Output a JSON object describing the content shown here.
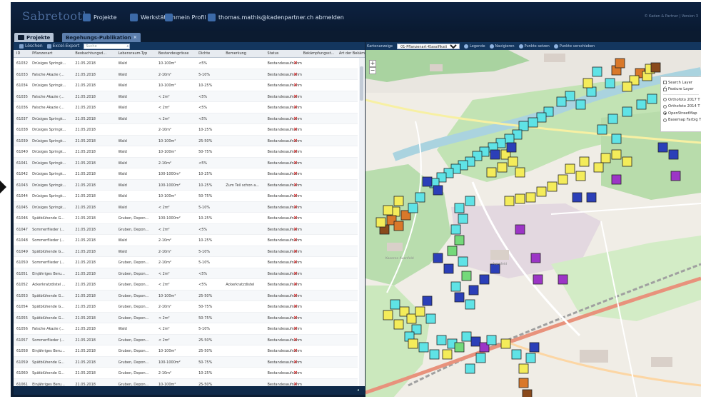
{
  "app": {
    "logo": "Sabretooth",
    "nav": [
      {
        "label": "Projekte"
      },
      {
        "label": "Werkstätten"
      },
      {
        "label": "mein Profil"
      },
      {
        "label": "thomas.mathis@kadenpartner.ch abmelden"
      }
    ],
    "top_right": "© Kaden & Partner | Version 3"
  },
  "tabs": [
    {
      "label": "Projekte"
    },
    {
      "label": "Begehungs-Publikation",
      "close": "×"
    }
  ],
  "grid_toolbar": {
    "delete": "Löschen",
    "export": "Excel-Export",
    "search_placeholder": "Suche"
  },
  "grid": {
    "headers": [
      "ID",
      "Pflanzenart",
      "Beobachtungsd...",
      "Lebensraum-Typ",
      "Bestandesgrösse",
      "Dichte",
      "Bemerkung",
      "Status",
      "Bekämpfungsst...",
      "Art der Bekämpf"
    ],
    "rows": [
      [
        "61032",
        "Drüsiges Springk...",
        "21.05.2018",
        "Wald",
        "10-100m²",
        "<5%",
        "",
        "Bestandesaufnahme"
      ],
      [
        "61033",
        "Falsche Akazie (...",
        "21.05.2018",
        "Wald",
        "2-10m²",
        "5-10%",
        "",
        "Bestandesaufnahme"
      ],
      [
        "61034",
        "Drüsiges Springk...",
        "21.05.2018",
        "Wald",
        "10-100m²",
        "10-25%",
        "",
        "Bestandesaufnahme"
      ],
      [
        "61035",
        "Falsche Akazie (...",
        "21.05.2018",
        "Wald",
        "< 2m²",
        "<5%",
        "",
        "Bestandesaufnahme"
      ],
      [
        "61036",
        "Falsche Akazie (...",
        "21.05.2018",
        "Wald",
        "< 2m²",
        "<5%",
        "",
        "Bestandesaufnahme"
      ],
      [
        "61037",
        "Drüsiges Springk...",
        "21.05.2018",
        "Wald",
        "< 2m²",
        "<5%",
        "",
        "Bestandesaufnahme"
      ],
      [
        "61038",
        "Drüsiges Springk...",
        "21.05.2018",
        "",
        "2-10m²",
        "10-25%",
        "",
        "Bestandesaufnahme"
      ],
      [
        "61039",
        "Drüsiges Springk...",
        "21.05.2018",
        "Wald",
        "10-100m²",
        "25-50%",
        "",
        "Bestandesaufnahme"
      ],
      [
        "61040",
        "Drüsiges Springk...",
        "21.05.2018",
        "Wald",
        "10-100m²",
        "50-75%",
        "",
        "Bestandesaufnahme"
      ],
      [
        "61041",
        "Drüsiges Springk...",
        "21.05.2018",
        "Wald",
        "2-10m²",
        "<5%",
        "",
        "Bestandesaufnahme"
      ],
      [
        "61042",
        "Drüsiges Springk...",
        "21.05.2018",
        "Wald",
        "100-1000m²",
        "10-25%",
        "",
        "Bestandesaufnahme"
      ],
      [
        "61043",
        "Drüsiges Springk...",
        "21.05.2018",
        "Wald",
        "100-1000m²",
        "10-25%",
        "Zum Teil schon a...",
        "Bestandesaufnahme"
      ],
      [
        "61044",
        "Drüsiges Springk...",
        "21.05.2018",
        "Wald",
        "10-100m²",
        "50-75%",
        "",
        "Bestandesaufnahme"
      ],
      [
        "61045",
        "Drüsiges Springk...",
        "21.05.2018",
        "Wald",
        "< 2m²",
        "5-10%",
        "",
        "Bestandesaufnahme"
      ],
      [
        "61046",
        "Spätblühende G...",
        "21.05.2018",
        "Gruben, Depon...",
        "100-1000m²",
        "10-25%",
        "",
        "Bestandesaufnahme"
      ],
      [
        "61047",
        "Sommerflieder (...",
        "21.05.2018",
        "Gruben, Depon...",
        "< 2m²",
        "<5%",
        "",
        "Bestandesaufnahme"
      ],
      [
        "61048",
        "Sommerflieder (...",
        "21.05.2018",
        "Wald",
        "2-10m²",
        "10-25%",
        "",
        "Bestandesaufnahme"
      ],
      [
        "61049",
        "Spätblühende G...",
        "21.05.2018",
        "Wald",
        "2-10m²",
        "5-10%",
        "",
        "Bestandesaufnahme"
      ],
      [
        "61050",
        "Sommerflieder (...",
        "21.05.2018",
        "Gruben, Depon...",
        "2-10m²",
        "5-10%",
        "",
        "Bestandesaufnahme"
      ],
      [
        "61051",
        "Einjähriges Beru...",
        "21.05.2018",
        "Gruben, Depon...",
        "< 2m²",
        "<5%",
        "",
        "Bestandesaufnahme"
      ],
      [
        "61052",
        "Ackerkratzdistel ...",
        "21.05.2018",
        "Gruben, Depon...",
        "< 2m²",
        "<5%",
        "Ackerkratzdistel",
        "Bestandesaufnahme"
      ],
      [
        "61053",
        "Spätblühende G...",
        "21.05.2018",
        "Gruben, Depon...",
        "10-100m²",
        "25-50%",
        "",
        "Bestandesaufnahme"
      ],
      [
        "61054",
        "Spätblühende G...",
        "21.05.2018",
        "Gruben, Depon...",
        "2-10m²",
        "50-75%",
        "",
        "Bestandesaufnahme"
      ],
      [
        "61055",
        "Spätblühende G...",
        "21.05.2018",
        "Gruben, Depon...",
        "< 2m²",
        "50-75%",
        "",
        "Bestandesaufnahme"
      ],
      [
        "61056",
        "Falsche Akazie (...",
        "21.05.2018",
        "Wald",
        "< 2m²",
        "5-10%",
        "",
        "Bestandesaufnahme"
      ],
      [
        "61057",
        "Sommerflieder (...",
        "21.05.2018",
        "Gruben, Depon...",
        "< 2m²",
        "25-50%",
        "",
        "Bestandesaufnahme"
      ],
      [
        "61058",
        "Einjähriges Beru...",
        "21.05.2018",
        "Gruben, Depon...",
        "10-100m²",
        "25-50%",
        "",
        "Bestandesaufnahme"
      ],
      [
        "61059",
        "Spätblühende G...",
        "21.05.2018",
        "Gruben, Depon...",
        "100-1000m²",
        "50-75%",
        "",
        "Bestandesaufnahme"
      ],
      [
        "61060",
        "Spätblühende G...",
        "21.05.2018",
        "Gruben, Depon...",
        "2-10m²",
        "10-25%",
        "",
        "Bestandesaufnahme"
      ],
      [
        "61061",
        "Einjähriges Beru...",
        "21.05.2018",
        "Gruben, Depon...",
        "10-100m²",
        "25-50%",
        "",
        "Bestandesaufnahme"
      ]
    ],
    "cancel_glyph": "×"
  },
  "map_toolbar": {
    "label": "Kartenanzeige",
    "select_value": "01-Pflanzenart-Klassifikati",
    "buttons": [
      "Legende",
      "Navigieren",
      "Punkte setzen",
      "Punkte verschieben"
    ]
  },
  "map": {
    "zoom_in": "+",
    "zoom_out": "−",
    "layers": [
      {
        "label": "Search Layer",
        "type": "checkbox",
        "checked": false
      },
      {
        "label": "Feature Layer",
        "type": "checkbox",
        "checked": true
      },
      {
        "label": "Orthofoto 2017 T",
        "type": "radio",
        "checked": false
      },
      {
        "label": "Orthofoto 2014 T",
        "type": "radio",
        "checked": false
      },
      {
        "label": "OpenStreetMap",
        "type": "radio",
        "checked": true
      },
      {
        "label": "Basemap Farbig T",
        "type": "radio",
        "checked": false
      }
    ],
    "place_labels": [
      "Kaserne Auenfeld",
      "Auenfeld"
    ],
    "category_colors": {
      "yellow": "#f4ec5a",
      "cyan": "#5fe3e6",
      "blue": "#2b3fb8",
      "purple": "#9c35c6",
      "green": "#74d97a",
      "orange": "#d9782a",
      "brown": "#8a4a1c"
    }
  }
}
